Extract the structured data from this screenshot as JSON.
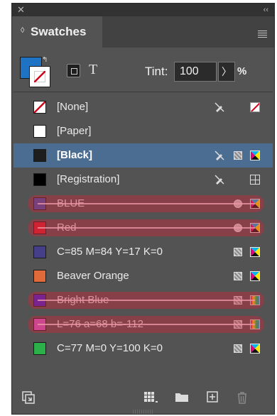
{
  "panel": {
    "title": "Swatches",
    "close_icon": "close-icon",
    "collapse_label": "‹‹",
    "menu_icon": "panel-menu-icon"
  },
  "controls": {
    "fill_color": "#1f73c4",
    "swap_label": "↰",
    "text_button": "T",
    "tint_label": "Tint:",
    "tint_value": "100",
    "tint_arrow": "〉",
    "tint_unit": "%"
  },
  "swatches": [
    {
      "name": "[None]",
      "color": "none",
      "non_editable": true,
      "type": "none",
      "selected": false,
      "highlighted": false
    },
    {
      "name": "[Paper]",
      "color": "#ffffff",
      "non_editable": false,
      "type": "",
      "selected": false,
      "highlighted": false
    },
    {
      "name": "[Black]",
      "color": "#1e1e1e",
      "non_editable": true,
      "mode": "process",
      "type": "cmyk",
      "selected": true,
      "highlighted": false
    },
    {
      "name": "[Registration]",
      "color": "#000000",
      "non_editable": true,
      "type": "registration",
      "selected": false,
      "highlighted": false
    },
    {
      "name": "BLUE",
      "color": "#3a56b0",
      "non_editable": false,
      "mode": "spot",
      "type": "cmyk",
      "selected": false,
      "highlighted": true
    },
    {
      "name": "Red",
      "color": "#d6202e",
      "non_editable": false,
      "mode": "spot",
      "type": "cmyk",
      "selected": false,
      "highlighted": true
    },
    {
      "name": "C=85 M=84 Y=17 K=0",
      "color": "#453f8a",
      "non_editable": false,
      "mode": "process",
      "type": "cmyk",
      "selected": false,
      "highlighted": false
    },
    {
      "name": "Beaver Orange",
      "color": "#e06a3a",
      "non_editable": false,
      "mode": "process",
      "type": "cmyk",
      "selected": false,
      "highlighted": false
    },
    {
      "name": "Bright Blue",
      "color": "#3a1fd6",
      "non_editable": false,
      "mode": "process",
      "type": "rgb",
      "selected": false,
      "highlighted": true
    },
    {
      "name": "L=76 a=68 b=-112",
      "color": "#d35fcf",
      "non_editable": false,
      "mode": "process",
      "type": "lab",
      "selected": false,
      "highlighted": true
    },
    {
      "name": "C=77 M=0 Y=100 K=0",
      "color": "#2bb04a",
      "non_editable": false,
      "mode": "process",
      "type": "cmyk",
      "selected": false,
      "highlighted": false
    }
  ],
  "bottom_bar": {
    "show_kinds_icon": "show-swatch-kinds-icon",
    "group_icon": "new-color-group-icon",
    "folder_icon": "folder-icon",
    "new_icon": "new-swatch-icon",
    "trash_icon": "trash-icon"
  }
}
